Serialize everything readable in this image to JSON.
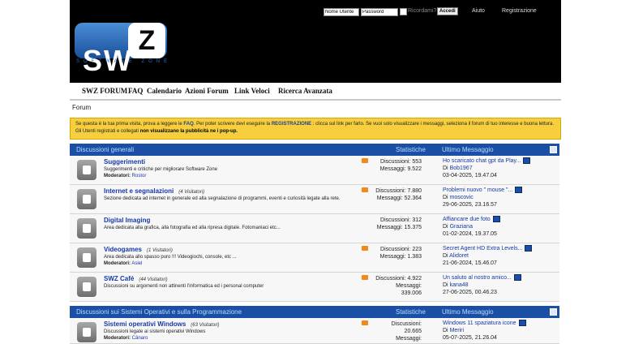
{
  "header": {
    "logo_letters": "SW",
    "logo_z": "Z",
    "logo_sub": "SOFTWARE ZONE",
    "login": {
      "user_placeholder": "Nome Utente",
      "pass_placeholder": "Password",
      "remember": "Ricordami?",
      "submit": "Accedi"
    },
    "links": [
      "Aiuto",
      "Registrazione"
    ]
  },
  "nav": [
    "SWZ FORUM",
    "FAQ",
    "Calendario",
    "Azioni Forum",
    "Link Veloci",
    "Ricerca Avanzata"
  ],
  "breadcrumb": "Forum",
  "notice": {
    "t1": "Se questa è la tua prima visita, prova a leggere le ",
    "faq": "FAQ",
    "t2": ". Per poter scrivere devi eseguire la ",
    "reg": "REGISTRAZIONE",
    "t3": " : clicca sul link per farlo. Se vuoi solo visualizzare i messaggi, seleziona il forum di tuo interesse e buona lettura. Gli Utenti registrati e collegati ",
    "bold": "non visualizzano la pubblicità ne i pop-up."
  },
  "categories": [
    {
      "title": "Discussioni generali",
      "stats": "Statistiche",
      "last": "Ultimo Messaggio"
    },
    {
      "title": "Discussioni sui Sistemi Operativi e sulla Programmazione",
      "stats": "Statistiche",
      "last": "Ultimo Messaggio"
    }
  ],
  "forums": [
    {
      "title": "Suggerimenti",
      "visitors": "",
      "desc": "Suggerimenti e critiche per migliorare Software Zone",
      "mods_label": "Moderatori:",
      "mods": "Rostor",
      "disc": "Discussioni: 553",
      "msg": "Messaggi: 9.522",
      "last_title": "Ho scaricato chat gpt da Play...",
      "by": "Di ",
      "user": "Bob1967",
      "date": "03-04-2025, 19.47.04"
    },
    {
      "title": "Internet e segnalazioni",
      "visitors": "(4 Visitatori)",
      "desc": "Sezione dedicata ad internet in generale ed alla segnalazione di programmi, eventi e curiosità legate alla rete.",
      "mods_label": "",
      "mods": "",
      "disc": "Discussioni: 7.880",
      "msg": "Messaggi: 52.364",
      "last_title": "Problemi nuovo \" mouse \"...",
      "by": "Di ",
      "user": "moscovic",
      "date": "29-06-2025, 23.16.57"
    },
    {
      "title": "Digital Imaging",
      "visitors": "",
      "desc": "Area dedicata alla grafica, alla fotografia ed alla ripresa digitale. Fotomaniaci etc...",
      "mods_label": "",
      "mods": "",
      "disc": "Discussioni: 312",
      "msg": "Messaggi: 15.375",
      "last_title": "Affiancare due foto",
      "by": "Di ",
      "user": "Graziana",
      "date": "01-02-2024, 19.37.05"
    },
    {
      "title": "Videogames",
      "visitors": "(1 Visitatori)",
      "desc": "Area dedicata allo spasso puro !!! Videogiochi, console, etc ...",
      "mods_label": "Moderatori:",
      "mods": "Asiel",
      "disc": "Discussioni: 223",
      "msg": "Messaggi: 1.383",
      "last_title": "Secret Agent HD Extra Levels...",
      "by": "Di ",
      "user": "Alidoret",
      "date": "21-06-2024, 15.46.07"
    },
    {
      "title": "SWZ Café",
      "visitors": "(44 Visitatori)",
      "desc": "Discussioni su argomenti non attinenti l'informatica ed i personal computer",
      "mods_label": "",
      "mods": "",
      "disc": "Discussioni: 4.922",
      "msg": "Messaggi:",
      "msg2": "339.006",
      "last_title": "Un saluto al nostro amico...",
      "by": "Di ",
      "user": "kana48",
      "date": "27-06-2025, 00.46.23"
    },
    {
      "title": "Sistemi operativi Windows",
      "visitors": "(63 Visitatori)",
      "desc": "Discussioni legate ai sistemi operativi Windows",
      "mods_label": "Moderatori:",
      "mods": "Cânaro",
      "disc": "Discussioni:",
      "disc2": "20.665",
      "msg": "Messaggi:",
      "last_title": "Windows 11 spaziatura icone",
      "by": "Di ",
      "user": "Meriri",
      "date": "05-07-2025, 21.26.04"
    }
  ]
}
